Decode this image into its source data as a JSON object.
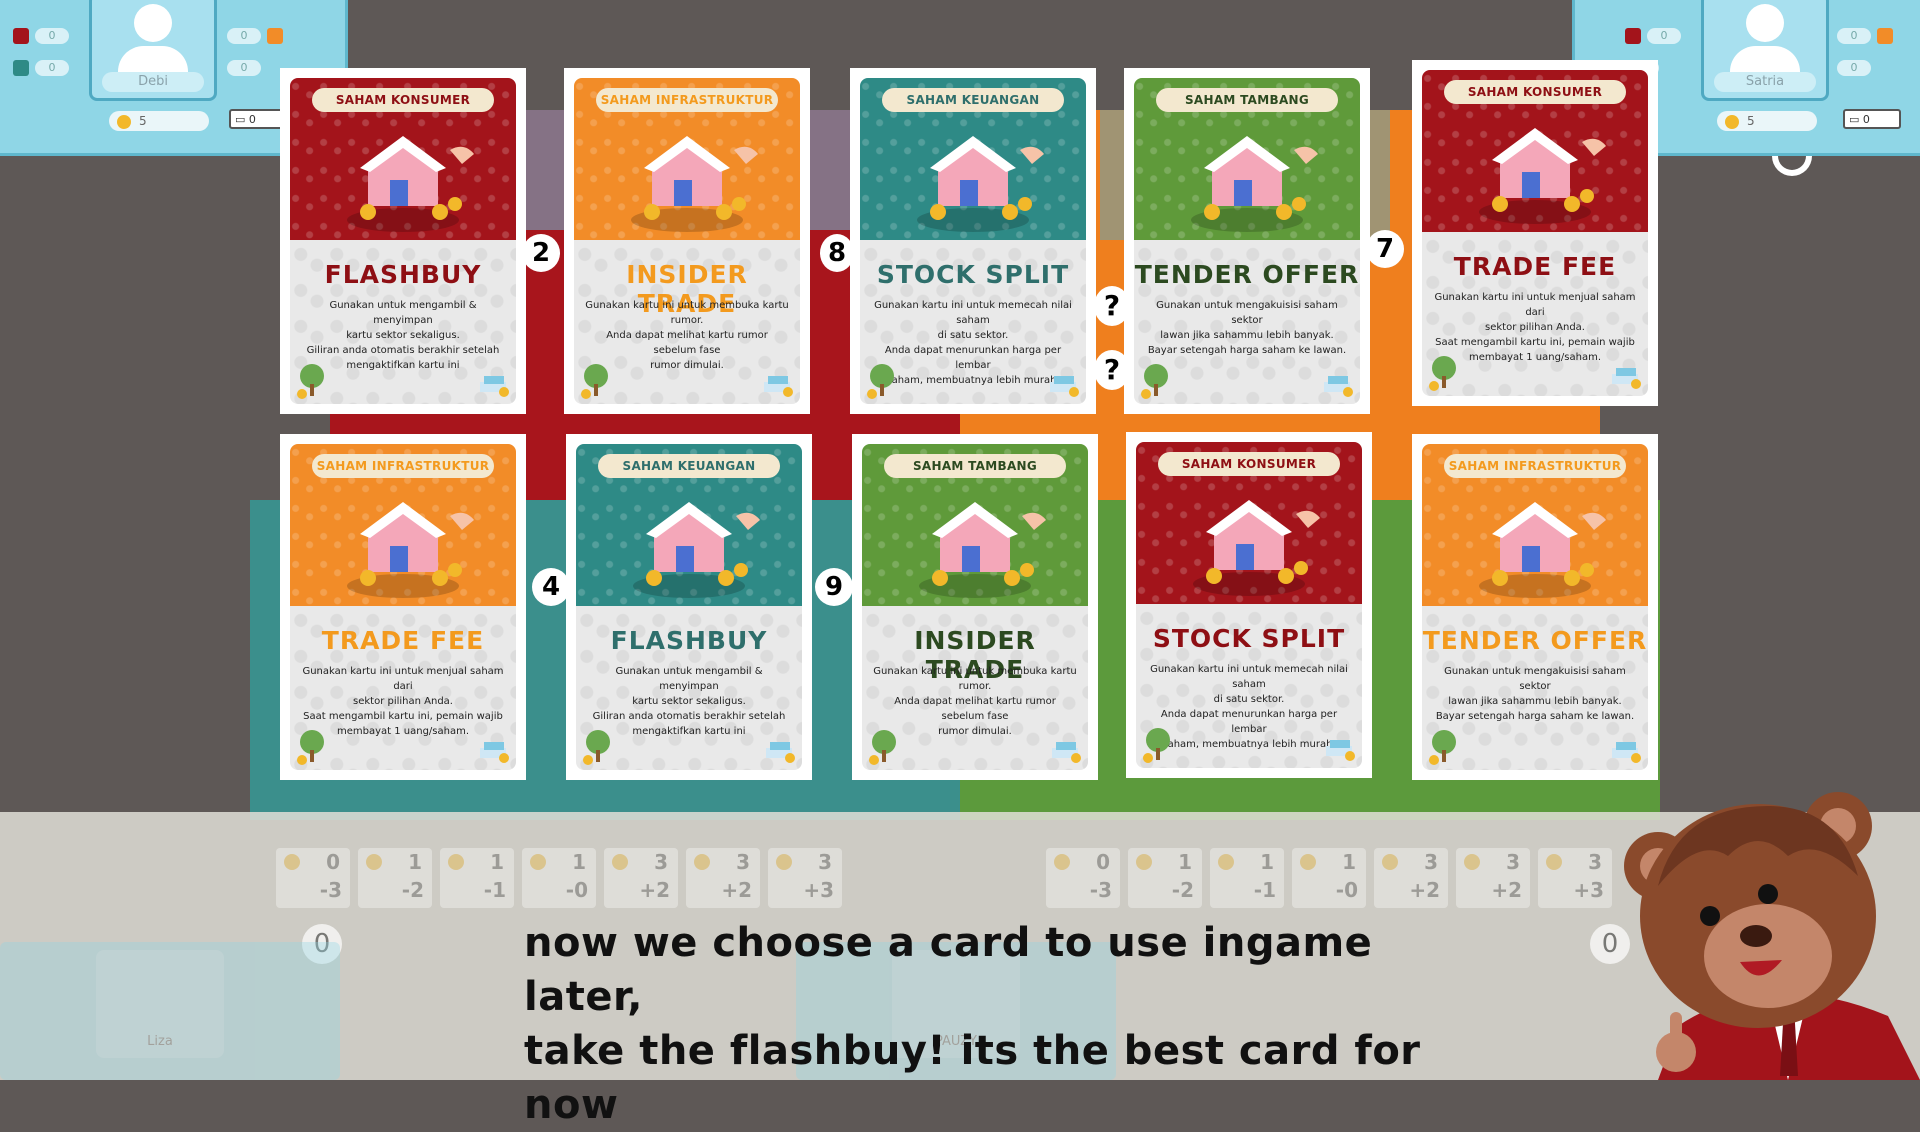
{
  "players": [
    {
      "name": "Debi",
      "stats": [
        "0",
        "0",
        "0",
        "0"
      ],
      "coins": "5",
      "aux_value": "0"
    },
    {
      "name": "Satria",
      "stats": [
        "0",
        "0",
        "0",
        "0"
      ],
      "coins": "5",
      "aux_value": "0"
    },
    {
      "name": "Liza"
    },
    {
      "name": "PAUZY"
    }
  ],
  "board": {
    "left_numbers": [
      "2",
      "4"
    ],
    "mid_numbers": [
      "8",
      "9"
    ],
    "right_numbers": [
      "7"
    ],
    "question_marks": [
      "?",
      "?"
    ],
    "bottom_circles": [
      "0",
      "0"
    ],
    "tracks_left": [
      {
        "top": "0",
        "bottom": "-3"
      },
      {
        "top": "1",
        "bottom": "-2"
      },
      {
        "top": "1",
        "bottom": "-1"
      },
      {
        "top": "1",
        "bottom": "-0"
      },
      {
        "top": "3",
        "bottom": "+2"
      },
      {
        "top": "3",
        "bottom": "+2"
      },
      {
        "top": "3",
        "bottom": "+3"
      }
    ],
    "tracks_right": [
      {
        "top": "0",
        "bottom": "-3"
      },
      {
        "top": "1",
        "bottom": "-2"
      },
      {
        "top": "1",
        "bottom": "-1"
      },
      {
        "top": "1",
        "bottom": "-0"
      },
      {
        "top": "3",
        "bottom": "+2"
      },
      {
        "top": "3",
        "bottom": "+2"
      },
      {
        "top": "3",
        "bottom": "+3"
      }
    ]
  },
  "cards": [
    {
      "sector": "SAHAM KONSUMER",
      "title": "FLASHBUY",
      "desc": [
        "Gunakan untuk mengambil & menyimpan",
        "kartu sektor sekaligus.",
        "Giliran anda otomatis berakhir setelah",
        "mengaktifkan kartu ini"
      ],
      "bg": "#a3141b",
      "title_color": "#8e0f14",
      "art": "house-hand-icon"
    },
    {
      "sector": "SAHAM INFRASTRUKTUR",
      "title": "INSIDER TRADE",
      "desc": [
        "Gunakan kartu ini untuk membuka kartu",
        "rumor.",
        "Anda dapat melihat kartu rumor sebelum fase",
        "rumor dimulai."
      ],
      "bg": "#f28c28",
      "title_color": "#f39a1e",
      "art": "piggy-bank-icon"
    },
    {
      "sector": "SAHAM KEUANGAN",
      "title": "STOCK SPLIT",
      "desc": [
        "Gunakan kartu ini untuk memecah nilai saham",
        "di satu sektor.",
        "Anda dapat menurunkan harga per lembar",
        "saham, membuatnya lebih murah."
      ],
      "bg": "#2e8a86",
      "title_color": "#2f6f6c",
      "art": "clipboard-icon"
    },
    {
      "sector": "SAHAM TAMBANG",
      "title": "TENDER OFFER",
      "desc": [
        "Gunakan untuk mengakuisisi saham sektor",
        "lawan jika sahammu lebih banyak.",
        "Bayar setengah harga saham ke lawan."
      ],
      "bg": "#5f9a3a",
      "title_color": "#2c4a20",
      "art": "invest-house-icon"
    },
    {
      "sector": "SAHAM KONSUMER",
      "title": "TRADE FEE",
      "desc": [
        "Gunakan kartu ini untuk menjual saham dari",
        "sektor pilihan Anda.",
        "Saat mengambil kartu ini, pemain wajib",
        "membayat 1 uang/saham."
      ],
      "bg": "#a3141b",
      "title_color": "#8e0f14",
      "art": "globe-money-icon"
    },
    {
      "sector": "SAHAM INFRASTRUKTUR",
      "title": "TRADE FEE",
      "desc": [
        "Gunakan kartu ini untuk menjual saham dari",
        "sektor pilihan Anda.",
        "Saat mengambil kartu ini, pemain wajib",
        "membayat 1 uang/saham."
      ],
      "bg": "#f28c28",
      "title_color": "#f39a1e",
      "art": "globe-money-icon"
    },
    {
      "sector": "SAHAM KEUANGAN",
      "title": "FLASHBUY",
      "desc": [
        "Gunakan untuk mengambil & menyimpan",
        "kartu sektor sekaligus.",
        "Giliran anda otomatis berakhir setelah",
        "mengaktifkan kartu ini"
      ],
      "bg": "#2e8a86",
      "title_color": "#2f6f6c",
      "art": "house-hand-icon"
    },
    {
      "sector": "SAHAM TAMBANG",
      "title": "INSIDER TRADE",
      "desc": [
        "Gunakan kartu ini untuk membuka kartu",
        "rumor.",
        "Anda dapat melihat kartu rumor sebelum fase",
        "rumor dimulai."
      ],
      "bg": "#5f9a3a",
      "title_color": "#2c4a20",
      "art": "piggy-bank-icon"
    },
    {
      "sector": "SAHAM KONSUMER",
      "title": "STOCK SPLIT",
      "desc": [
        "Gunakan kartu ini untuk memecah nilai saham",
        "di satu sektor.",
        "Anda dapat menurunkan harga per lembar",
        "saham, membuatnya lebih murah."
      ],
      "bg": "#a3141b",
      "title_color": "#8e0f14",
      "art": "clipboard-icon"
    },
    {
      "sector": "SAHAM INFRASTRUKTUR",
      "title": "TENDER OFFER",
      "desc": [
        "Gunakan untuk mengakuisisi saham sektor",
        "lawan jika sahammu lebih banyak.",
        "Bayar setengah harga saham ke lawan."
      ],
      "bg": "#f28c28",
      "title_color": "#f39a1e",
      "art": "invest-house-icon"
    }
  ],
  "caption": {
    "line1": "now we choose a card to use ingame later,",
    "line2": "take the flashbuy! its the best card for now"
  },
  "mascot": "bear-mascot-icon"
}
